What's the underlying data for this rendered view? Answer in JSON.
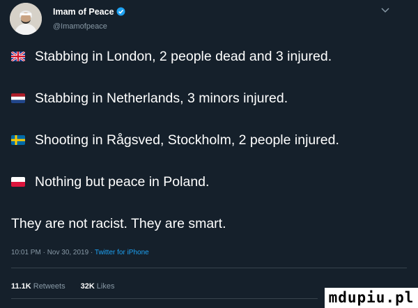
{
  "author": {
    "name": "Imam of Peace",
    "handle": "@Imamofpeace"
  },
  "tweet": {
    "lines": [
      {
        "flag": "uk-flag",
        "text": "Stabbing in London, 2 people dead and 3 injured."
      },
      {
        "flag": "netherlands-flag",
        "text": "Stabbing in Netherlands, 3 minors injured."
      },
      {
        "flag": "sweden-flag",
        "text": "Shooting in Rågsved, Stockholm, 2 people injured."
      },
      {
        "flag": "poland-flag",
        "text": "Nothing but peace in Poland."
      }
    ],
    "closing": "They are not racist. They are smart."
  },
  "meta": {
    "timestamp": "10:01 PM · Nov 30, 2019 · ",
    "source": "Twitter for iPhone"
  },
  "stats": {
    "retweets_count": "11.1K",
    "retweets_label": "Retweets",
    "likes_count": "32K",
    "likes_label": "Likes"
  },
  "watermark": "mdupiu.pl",
  "colors": {
    "background": "#15202b",
    "secondary_text": "#8899a6",
    "link": "#1da1f2",
    "verified": "#1da1f2",
    "divider": "#38444d"
  }
}
